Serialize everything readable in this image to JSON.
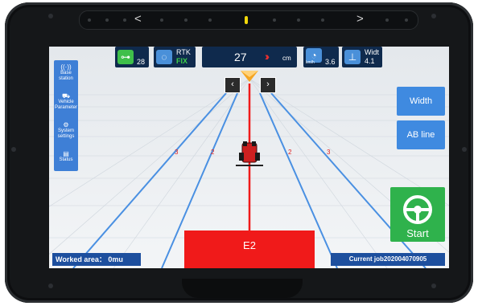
{
  "topbar": {
    "satellite_count": "28",
    "rtk_label": "RTK",
    "rtk_status": "FIX",
    "offset_value": "27",
    "offset_unit": "cm",
    "speed_unit": "km/h",
    "speed_value": "3.6",
    "width_label": "Widt",
    "width_value": "4.1"
  },
  "left_menu": [
    {
      "icon": "base-station-icon",
      "label": "Base station"
    },
    {
      "icon": "vehicle-icon",
      "label": "Vehicle Parameter"
    },
    {
      "icon": "settings-icon",
      "label": "System settings"
    },
    {
      "icon": "status-icon",
      "label": "Status"
    }
  ],
  "nav": {
    "prev": "‹",
    "next": "›"
  },
  "right_buttons": {
    "width": "Width",
    "ab_line": "AB line",
    "start": "Start"
  },
  "guidance": {
    "current_line": "E2",
    "line_labels": [
      "3",
      "2",
      "2",
      "3"
    ]
  },
  "footer": {
    "worked_area": "Worked area： 0mu",
    "current_job": "Current job202004070905"
  },
  "device": {
    "strip_left": "<",
    "strip_right": ">"
  },
  "colors": {
    "accent_blue": "#3f8ae0",
    "guide_red": "#f01a1a",
    "start_green": "#2fb24c",
    "line_blue": "#4a90e2",
    "topbar_navy": "#0f2a4d"
  }
}
